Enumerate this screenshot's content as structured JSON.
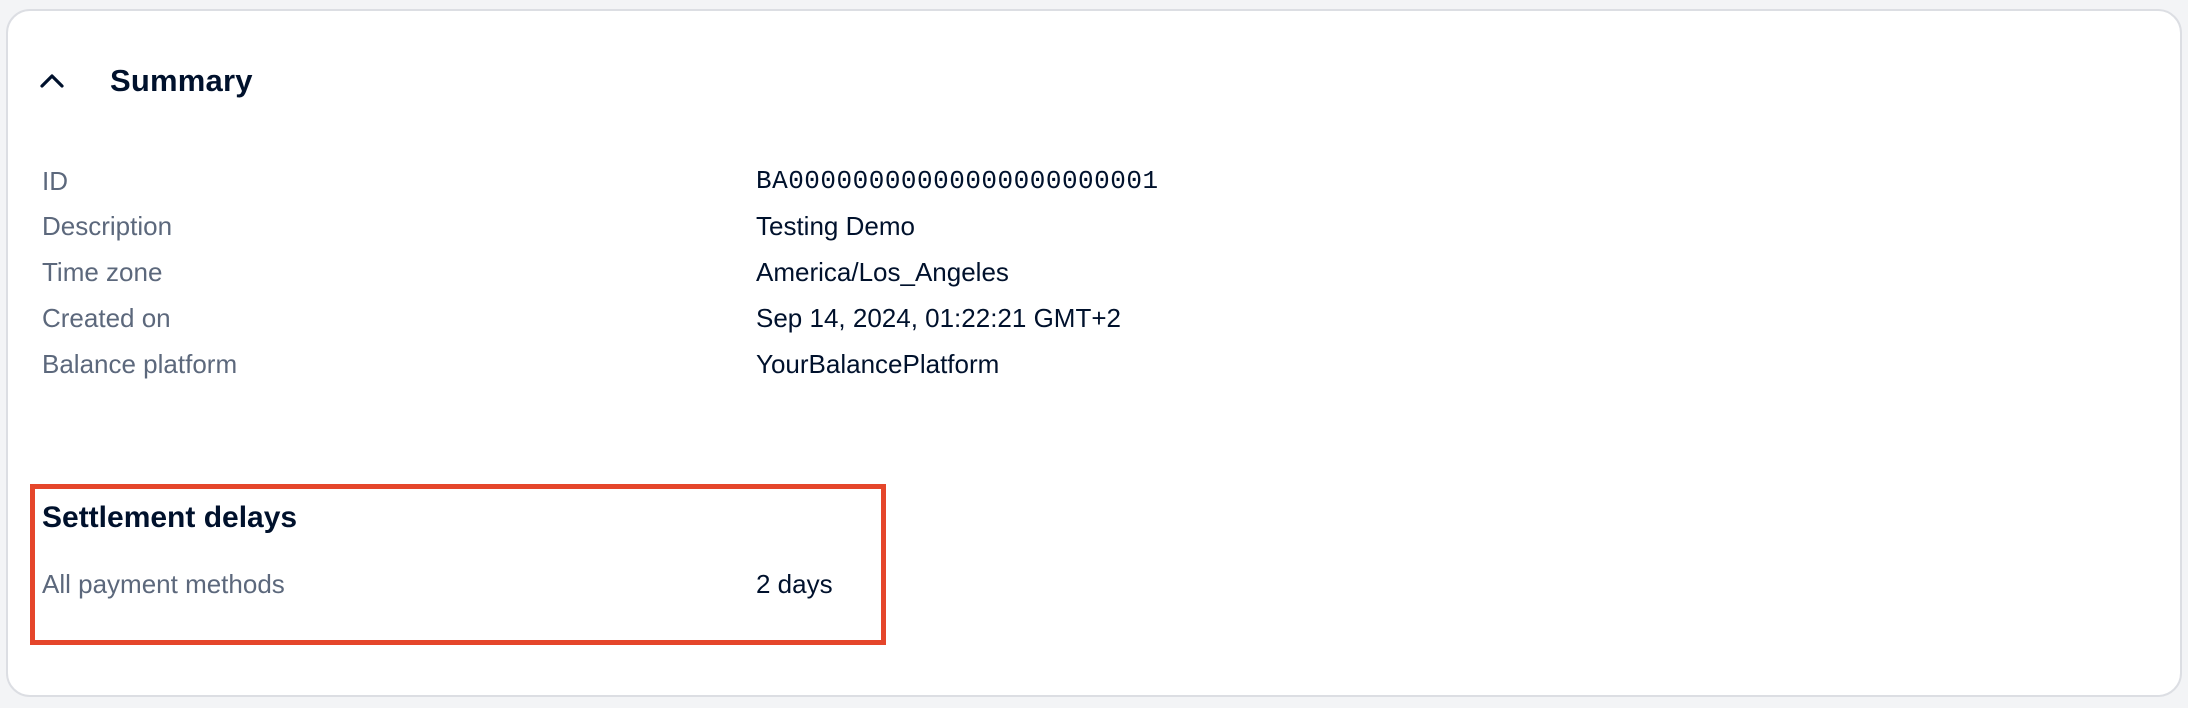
{
  "summary": {
    "title": "Summary",
    "toggle_icon": "chevron-up-icon",
    "rows": [
      {
        "label": "ID",
        "value": "BA00000000000000000000001"
      },
      {
        "label": "Description",
        "value": "Testing Demo"
      },
      {
        "label": "Time zone",
        "value": "America/Los_Angeles"
      },
      {
        "label": "Created on",
        "value": "Sep 14, 2024, 01:22:21 GMT+2"
      },
      {
        "label": "Balance platform",
        "value": "YourBalancePlatform"
      }
    ]
  },
  "settlement": {
    "title": "Settlement delays",
    "rows": [
      {
        "label": "All payment methods",
        "value": "2 days"
      }
    ]
  },
  "colors": {
    "highlight": "#e5462b",
    "text_primary": "#00112c",
    "text_secondary": "#5c687c",
    "border": "#dcdee3"
  }
}
